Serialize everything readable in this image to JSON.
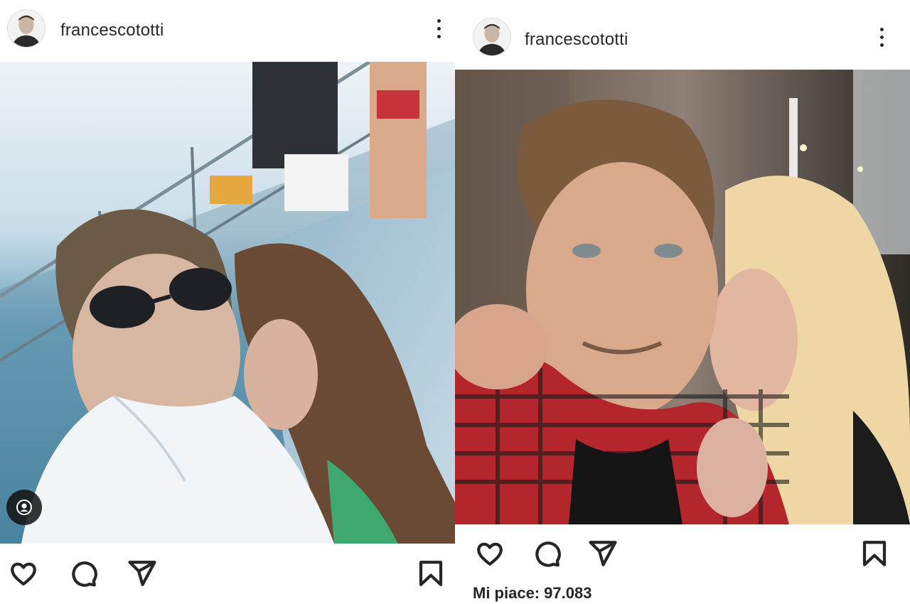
{
  "posts": [
    {
      "username": "francescototti",
      "menu_icon": "more-vertical-icon",
      "photo_description_icon": "photo",
      "tag_icon": "user-tag-icon",
      "actions": [
        "heart-icon",
        "comment-icon",
        "share-icon",
        "bookmark-icon"
      ]
    },
    {
      "username": "francescototti",
      "menu_icon": "more-vertical-icon",
      "actions": [
        "heart-icon",
        "comment-icon",
        "share-icon",
        "bookmark-icon"
      ],
      "likes_label": "Mi piace:",
      "likes_count": "97.083"
    }
  ],
  "colors": {
    "text": "#262626",
    "background": "#ffffff",
    "border": "#dbdbdb"
  }
}
